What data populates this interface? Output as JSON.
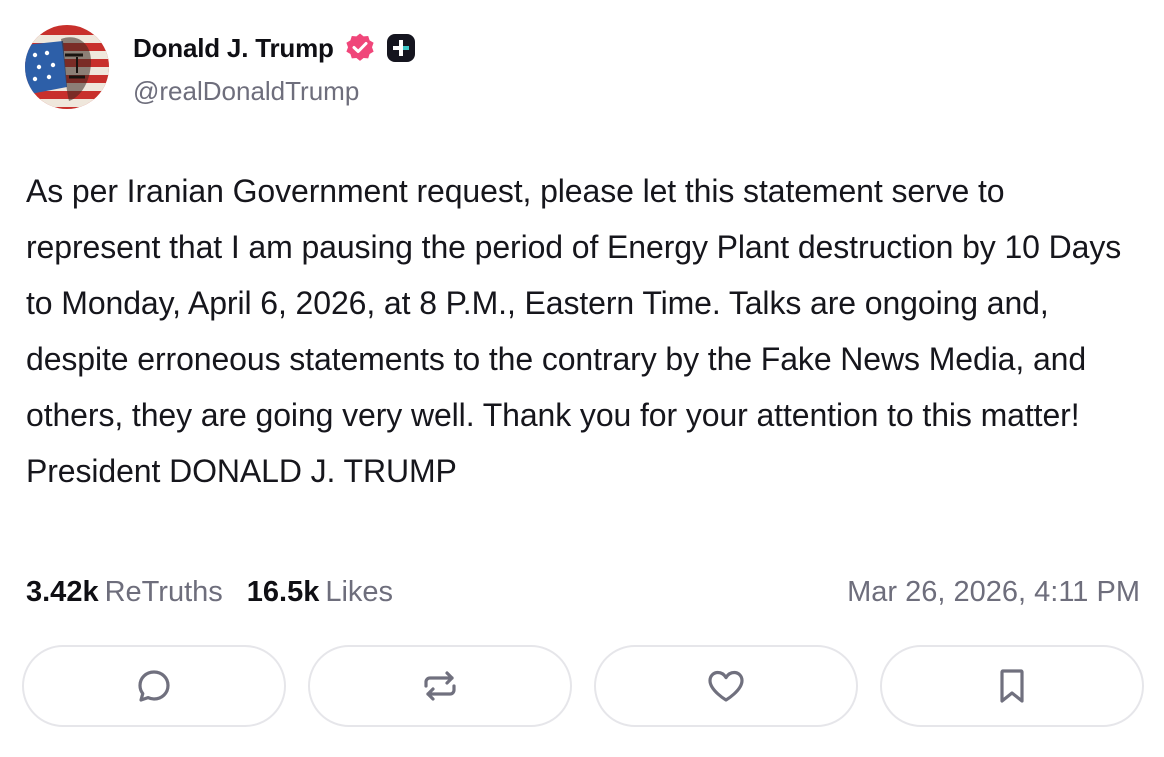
{
  "author": {
    "display_name": "Donald J. Trump",
    "handle": "@realDonaldTrump",
    "verified_badge_color": "#f0467a",
    "avatar_icon": "avatar-flag-portrait"
  },
  "post": {
    "text": "As per Iranian Government request, please let this statement serve to represent that I am pausing the period of Energy Plant destruction by 10 Days to Monday, April 6, 2026, at 8 P.M., Eastern Time. Talks are ongoing and, despite erroneous statements to the contrary by the Fake News Media, and others, they are going very well. Thank you for your attention to this matter! President DONALD J. TRUMP"
  },
  "stats": {
    "retruths_count": "3.42k",
    "retruths_label": "ReTruths",
    "likes_count": "16.5k",
    "likes_label": "Likes",
    "timestamp": "Mar 26, 2026, 4:11 PM"
  },
  "actions": [
    {
      "name": "reply",
      "icon": "comment-bubble-icon"
    },
    {
      "name": "retruth",
      "icon": "repost-arrows-icon"
    },
    {
      "name": "like",
      "icon": "heart-icon"
    },
    {
      "name": "bookmark",
      "icon": "bookmark-icon"
    }
  ],
  "colors": {
    "text_primary": "#0f0f14",
    "text_secondary": "#6e6e7c",
    "icon": "#70707e",
    "button_border": "#e6e6ea"
  }
}
